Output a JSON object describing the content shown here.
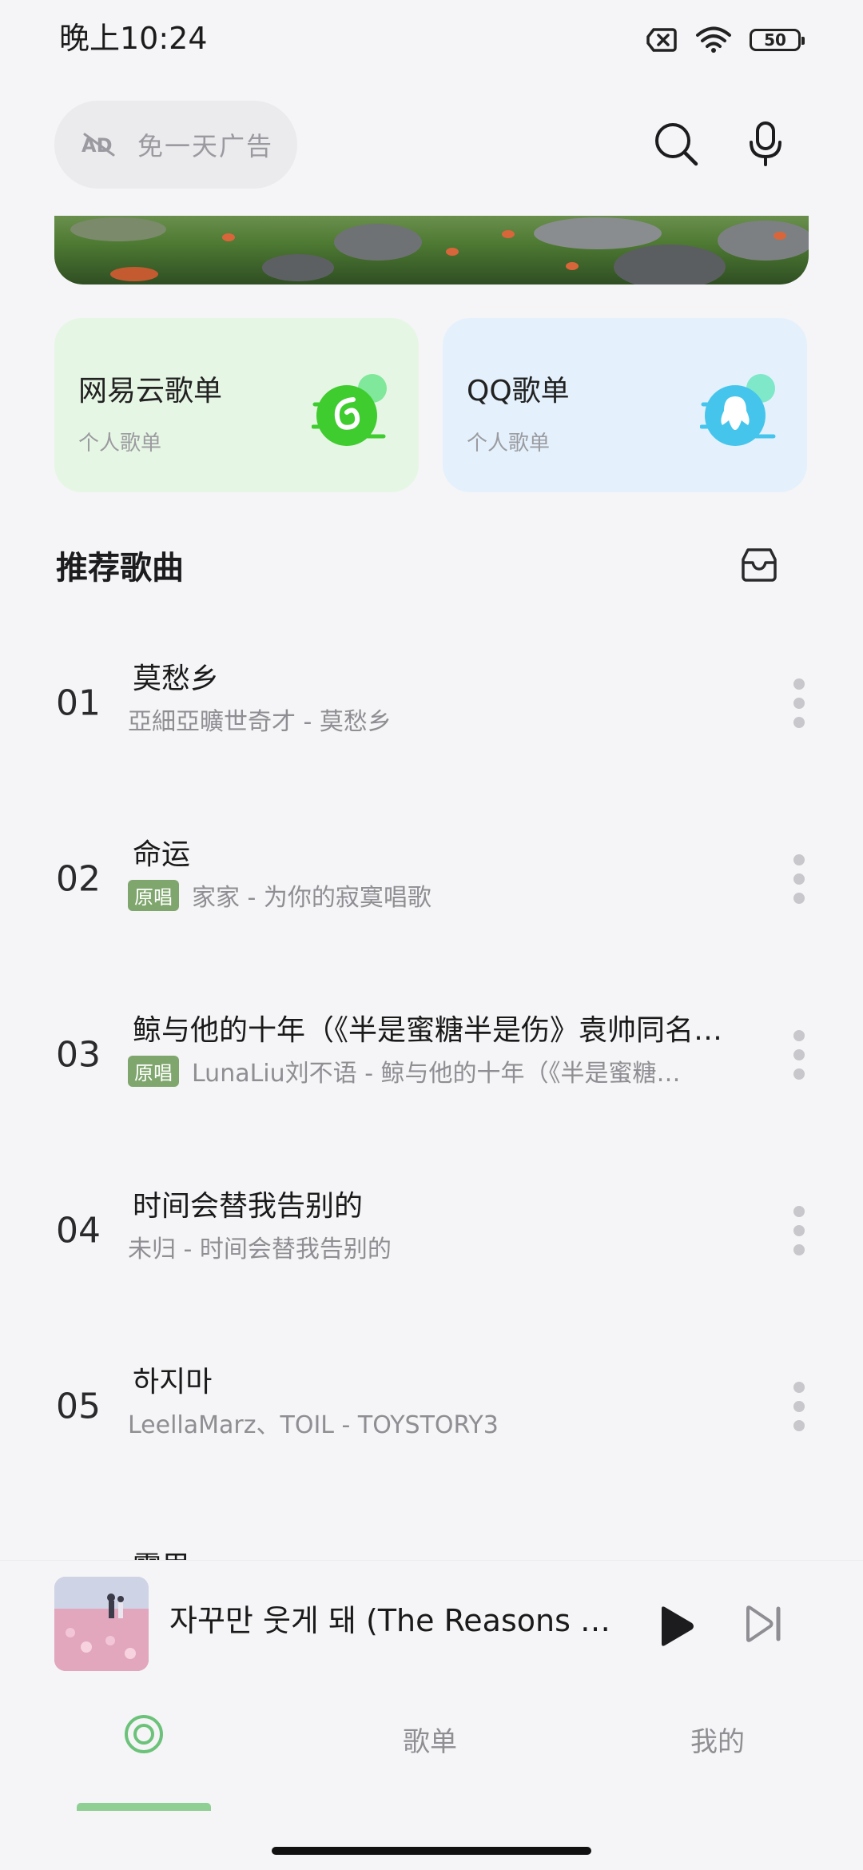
{
  "status_bar": {
    "time": "晚上10:24",
    "battery": "50"
  },
  "search": {
    "ad_free_label": "免一天广告"
  },
  "playlist_cards": [
    {
      "title": "网易云歌单",
      "subtitle": "个人歌单",
      "color": "#e6f6e4",
      "icon": "netease-cloud-icon"
    },
    {
      "title": "QQ歌单",
      "subtitle": "个人歌单",
      "color": "#e4f1fc",
      "icon": "qq-penguin-icon"
    }
  ],
  "recommend": {
    "title": "推荐歌曲",
    "songs": [
      {
        "num": "01",
        "title": "莫愁乡",
        "subtitle": "亞細亞曠世奇才 - 莫愁乡",
        "badge": ""
      },
      {
        "num": "02",
        "title": "命运",
        "subtitle": "家家 - 为你的寂寞唱歌",
        "badge": "原唱"
      },
      {
        "num": "03",
        "title": "鲸与他的十年（《半是蜜糖半是伤》袁帅同名…",
        "subtitle": "LunaLiu刘不语 - 鲸与他的十年（《半是蜜糖…",
        "badge": "原唱"
      },
      {
        "num": "04",
        "title": "时间会替我告别的",
        "subtitle": "未归 - 时间会替我告别的",
        "badge": ""
      },
      {
        "num": "05",
        "title": "하지마",
        "subtitle": "LeellaMarz、TOIL - TOYSTORY3",
        "badge": ""
      }
    ],
    "partial_title": "雾里"
  },
  "player": {
    "title": "자꾸만 웃게 돼 (The Reasons …"
  },
  "nav": {
    "items": [
      "歌单",
      "我的"
    ],
    "accent": "#6cc27a"
  }
}
